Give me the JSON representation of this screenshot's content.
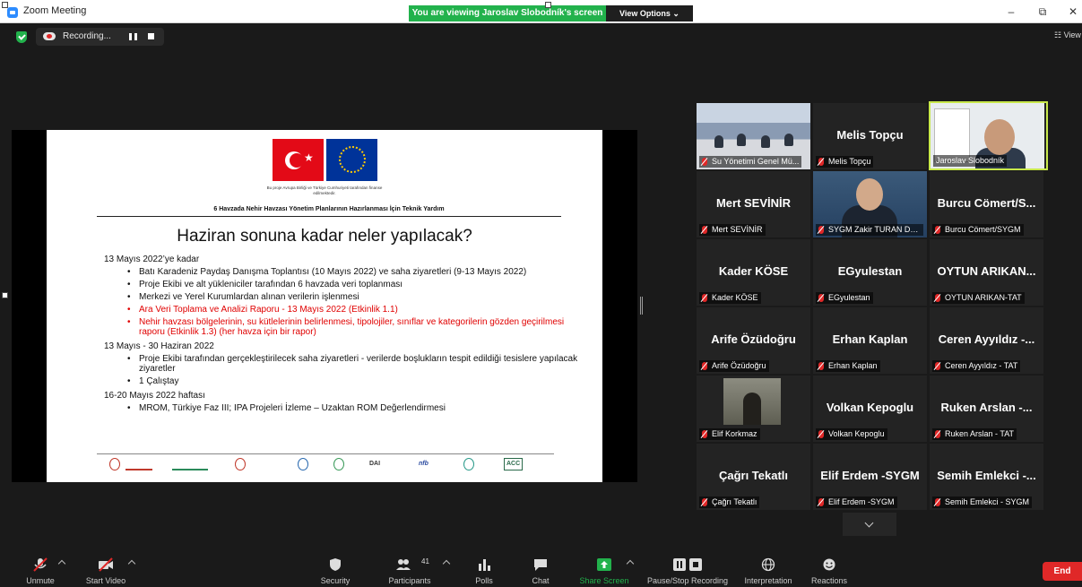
{
  "window": {
    "title": "Zoom Meeting",
    "share_banner": "You are viewing Jaroslav Slobodník's screen",
    "view_options": "View Options ⌄",
    "minimize": "–",
    "maximize": "⧉",
    "close": "✕"
  },
  "recording": {
    "label": "Recording..."
  },
  "view_toggle": "☷ View",
  "slide": {
    "flag_caption": "Bu proje Avrupa Birliği ve Türkiye Cumhuriyeti tarafından finanse edilmektedir.",
    "header": "6 Havzada Nehir Havzası Yönetim Planlarının Hazırlanması İçin Teknik Yardım",
    "title": "Haziran sonuna kadar neler yapılacak?",
    "sections": [
      {
        "heading": "13 Mayıs 2022’ye kadar",
        "items": [
          "Batı Karadeniz Paydaş Danışma Toplantısı (10 Mayıs 2022) ve saha ziyaretleri (9-13 Mayıs 2022)",
          "Proje Ekibi ve alt yükleniciler tarafından 6 havzada veri toplanması",
          "Merkezi ve Yerel Kurumlardan alınan verilerin işlenmesi",
          "Ara Veri Toplama ve Analizi Raporu - 13 Mayıs 2022 (Etkinlik 1.1)",
          "Nehir havzası bölgelerinin, su kütlelerinin belirlenmesi, tipolojiler, sınıflar ve kategorilerin gözden geçirilmesi raporu (Etkinlik 1.3) (her havza için bir rapor)"
        ]
      },
      {
        "heading": "13 Mayıs - 30 Haziran 2022",
        "items": [
          "Proje Ekibi tarafından gerçekleştirilecek saha ziyaretleri - verilerde boşlukların tespit edildiği tesislere yapılacak ziyaretler",
          "1 Çalıştay"
        ]
      },
      {
        "heading": "16-20 Mayıs 2022 haftası",
        "items": [
          "MROM, Türkiye Faz III; IPA Projeleri İzleme – Uzaktan ROM Değerlendirmesi"
        ]
      }
    ],
    "logos": [
      "DAI",
      "nfb",
      "ACC"
    ]
  },
  "gallery": [
    {
      "big": "",
      "caption": "Su Yönetimi Genel Mü..."
    },
    {
      "big": "Melis Topçu",
      "caption": "Melis Topçu"
    },
    {
      "big": "",
      "caption": "Jaroslav Slobodník"
    },
    {
      "big": "Mert SEVİNİR",
      "caption": "Mert SEVİNİR"
    },
    {
      "big": "",
      "caption": "SYGM Zakir TURAN Da..."
    },
    {
      "big": "Burcu Cömert/S...",
      "caption": "Burcu Cömert/SYGM"
    },
    {
      "big": "Kader KÖSE",
      "caption": "Kader KÖSE"
    },
    {
      "big": "EGyulestan",
      "caption": "EGyulestan"
    },
    {
      "big": "OYTUN ARIKAN...",
      "caption": "OYTUN ARIKAN-TAT"
    },
    {
      "big": "Arife Özüdoğru",
      "caption": "Arife Özüdoğru"
    },
    {
      "big": "Erhan Kaplan",
      "caption": "Erhan Kaplan"
    },
    {
      "big": "Ceren Ayyıldız -...",
      "caption": "Ceren Ayyıldız - TAT"
    },
    {
      "big": "",
      "caption": "Elif Korkmaz"
    },
    {
      "big": "Volkan Kepoglu",
      "caption": "Volkan Kepoglu"
    },
    {
      "big": "Ruken Arslan -...",
      "caption": "Ruken Arslan - TAT"
    },
    {
      "big": "Çağrı Tekatlı",
      "caption": "Çağrı Tekatlı"
    },
    {
      "big": "Elif Erdem -SYGM",
      "caption": "Elif Erdem -SYGM"
    },
    {
      "big": "Semih Emlekci -...",
      "caption": "Semih Emlekci - SYGM"
    }
  ],
  "toolbar": {
    "unmute": "Unmute",
    "start_video": "Start Video",
    "security": "Security",
    "participants": "Participants",
    "participants_count": "41",
    "polls": "Polls",
    "chat": "Chat",
    "share_screen": "Share Screen",
    "pause_recording": "Pause/Stop Recording",
    "interpretation": "Interpretation",
    "reactions": "Reactions",
    "end": "End"
  },
  "colors": {
    "share_green": "#22b24c",
    "end_red": "#e02828",
    "active_speaker": "#c8e84b",
    "slide_red_text": "#e00000"
  }
}
